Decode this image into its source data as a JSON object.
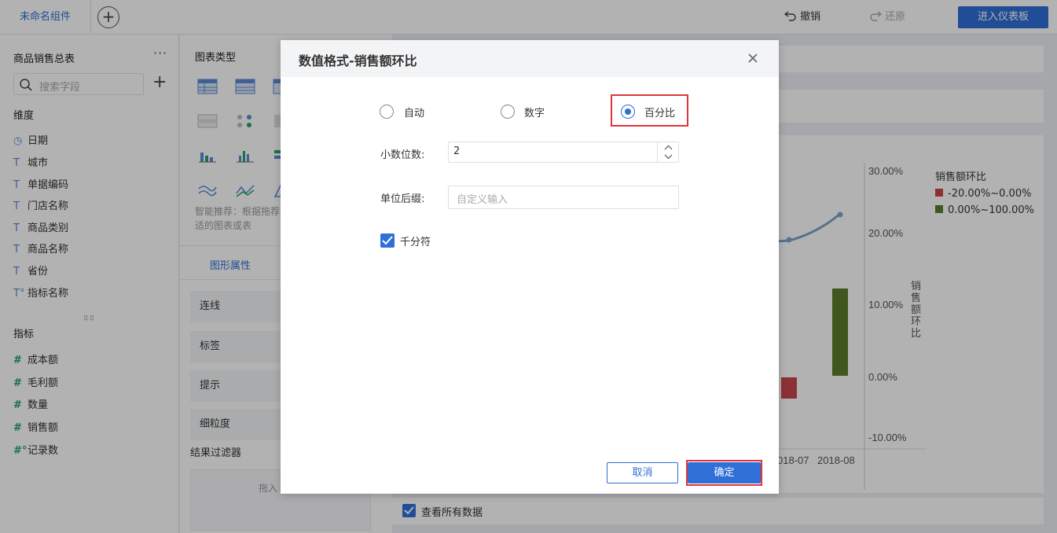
{
  "topbar": {
    "component_name": "未命名组件",
    "add_symbol": "+",
    "undo_label": "撤销",
    "redo_label": "还原",
    "dashboard_label": "进入仪表板"
  },
  "left_panel": {
    "table_name": "商品销售总表",
    "more": "···",
    "search_placeholder": "搜索字段",
    "add_symbol": "+",
    "dimension_title": "维度",
    "dimensions": [
      {
        "icon": "clock-icon",
        "glyph": "◷",
        "label": "日期"
      },
      {
        "icon": "text-icon",
        "glyph": "T",
        "label": "城市"
      },
      {
        "icon": "text-icon",
        "glyph": "T",
        "label": "单据编码"
      },
      {
        "icon": "text-icon",
        "glyph": "T",
        "label": "门店名称"
      },
      {
        "icon": "text-icon",
        "glyph": "T",
        "label": "商品类别"
      },
      {
        "icon": "text-icon",
        "glyph": "T",
        "label": "商品名称"
      },
      {
        "icon": "text-icon",
        "glyph": "T",
        "label": "省份"
      },
      {
        "icon": "text-calc-icon",
        "glyph": "T°",
        "label": "指标名称"
      }
    ],
    "grip": "⠿⠿",
    "measure_title": "指标",
    "measures": [
      {
        "icon": "hash-icon",
        "glyph": "#",
        "label": "成本额"
      },
      {
        "icon": "hash-icon",
        "glyph": "#",
        "label": "毛利额"
      },
      {
        "icon": "hash-icon",
        "glyph": "#",
        "label": "数量"
      },
      {
        "icon": "hash-icon",
        "glyph": "#",
        "label": "销售额"
      },
      {
        "icon": "hash-calc-icon",
        "glyph": "#°",
        "label": "记录数"
      }
    ]
  },
  "mid_panel": {
    "chart_type_title": "图表类型",
    "hint": "智能推荐：根据拖荐合适的图表或表",
    "tab_graph_props": "图形属性",
    "props": [
      "连线",
      "标签",
      "提示",
      "细粒度"
    ],
    "filter_title": "结果过滤器",
    "filter_drop": "拖入"
  },
  "canvas": {
    "view_all_label": "查看所有数据",
    "chart_fragment": {
      "right_ticks": [
        "30.00%",
        "20.00%",
        "10.00%",
        "0.00%",
        "-10.00%"
      ],
      "right_axis_title": "销售额环比",
      "x_ticks": [
        "018-07",
        "2018-08"
      ],
      "legend_title": "销售额环比",
      "legend_items": [
        {
          "label": "-20.00%~0.00%",
          "color": "#c8474d"
        },
        {
          "label": "0.00%~100.00%",
          "color": "#5b7d2d"
        }
      ]
    }
  },
  "dialog": {
    "title": "数值格式-销售额环比",
    "format_options": [
      {
        "label": "自动",
        "selected": false
      },
      {
        "label": "数字",
        "selected": false
      },
      {
        "label": "百分比",
        "selected": true
      }
    ],
    "decimal_label": "小数位数:",
    "decimal_value": "2",
    "suffix_label": "单位后缀:",
    "suffix_placeholder": "自定义输入",
    "thousands_label": "千分符",
    "thousands_checked": true,
    "cancel_label": "取消",
    "ok_label": "确定"
  },
  "colors": {
    "accent": "#2f6fd6",
    "highlight": "#e0343c"
  }
}
